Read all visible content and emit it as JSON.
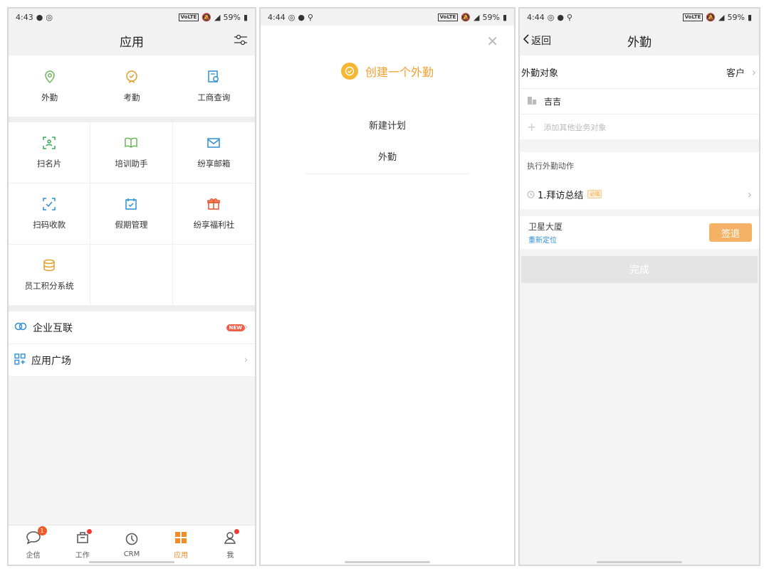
{
  "apps_screen": {
    "status": {
      "time": "4:43",
      "battery": "59%",
      "network": "VoLTE"
    },
    "title": "应用",
    "grid_top": [
      {
        "label": "外勤",
        "icon": "location-pin-icon"
      },
      {
        "label": "考勤",
        "icon": "check-badge-icon"
      },
      {
        "label": "工商查询",
        "icon": "document-search-icon"
      }
    ],
    "grid_main": [
      {
        "label": "扫名片",
        "icon": "scan-card-icon"
      },
      {
        "label": "培训助手",
        "icon": "book-icon"
      },
      {
        "label": "纷享邮箱",
        "icon": "mail-icon"
      },
      {
        "label": "扫码收款",
        "icon": "scan-pay-icon"
      },
      {
        "label": "假期管理",
        "icon": "calendar-check-icon"
      },
      {
        "label": "纷享福利社",
        "icon": "gift-icon"
      },
      {
        "label": "员工积分系统",
        "icon": "coins-icon"
      }
    ],
    "enterprise_link": {
      "label": "企业互联",
      "badge": "NEW"
    },
    "app_plaza": {
      "label": "应用广场"
    },
    "tabs": [
      {
        "label": "企信",
        "badge": "1"
      },
      {
        "label": "工作"
      },
      {
        "label": "CRM"
      },
      {
        "label": "应用"
      },
      {
        "label": "我"
      }
    ],
    "accent": "#f28c28"
  },
  "create_screen": {
    "status": {
      "time": "4:44",
      "battery": "59%",
      "network": "VoLTE"
    },
    "title": "创建一个外勤",
    "options": [
      "新建计划",
      "外勤"
    ],
    "accent": "#f6b731"
  },
  "field_screen": {
    "status": {
      "time": "4:44",
      "battery": "59%",
      "network": "VoLTE"
    },
    "back_label": "返回",
    "title": "外勤",
    "target_label": "外勤对象",
    "target_type": "客户",
    "customer_name": "吉吉",
    "add_object_placeholder": "添加其他业务对象",
    "action_section": "执行外勤动作",
    "action_item": "1.拜访总结",
    "required_tag": "必填",
    "location_name": "卫星大厦",
    "relocate_label": "重新定位",
    "checkout_label": "签退",
    "done_label": "完成"
  }
}
